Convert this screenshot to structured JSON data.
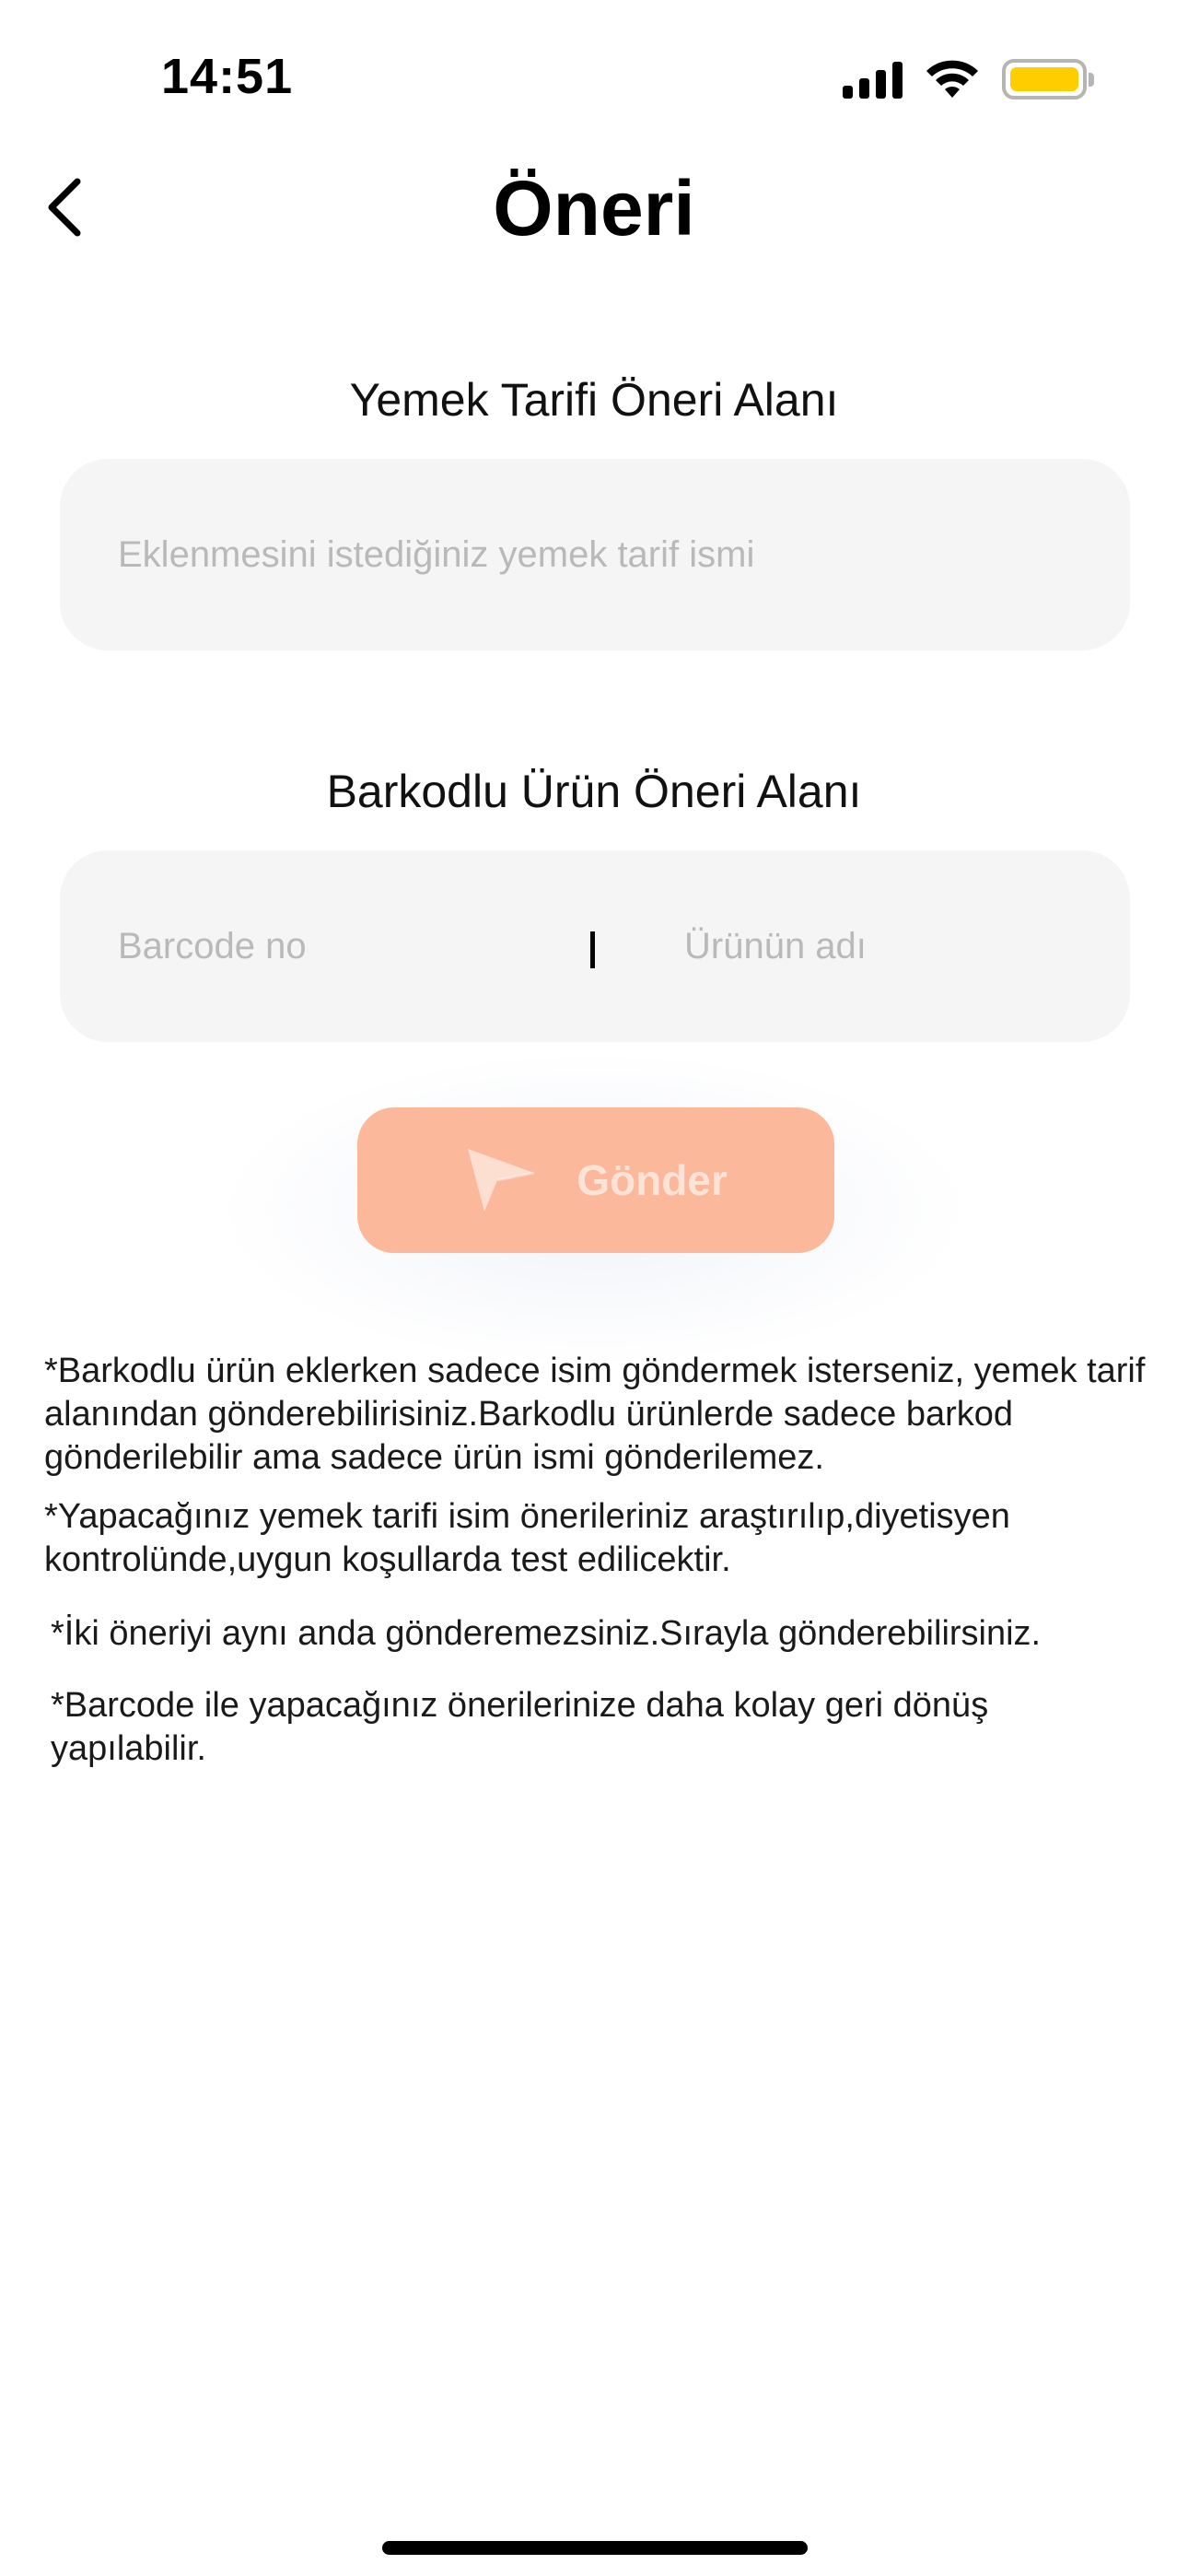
{
  "status_bar": {
    "time": "14:51"
  },
  "header": {
    "title": "Öneri"
  },
  "recipe_section": {
    "label": "Yemek Tarifi Öneri Alanı",
    "placeholder": "Eklenmesini istediğiniz yemek tarif ismi"
  },
  "barcode_section": {
    "label": "Barkodlu Ürün Öneri Alanı",
    "barcode_placeholder": "Barcode no",
    "product_placeholder": "Ürünün adı"
  },
  "send_button": {
    "label": "Gönder",
    "color": "#fbb89b"
  },
  "notes": [
    "*Barkodlu ürün eklerken sadece isim göndermek isterseniz, yemek tarif alanından gönderebilirisiniz.Barkodlu ürünlerde sadece barkod gönderilebilir ama sadece ürün ismi gönderilemez.",
    "*Yapacağınız yemek tarifi isim önerileriniz araştırılıp,diyetisyen kontrolünde,uygun koşullarda test edilicektir.",
    "*İki öneriyi aynı anda gönderemezsiniz.Sırayla gönderebilirsiniz.",
    "*Barcode ile yapacağınız önerilerinize daha kolay geri dönüş yapılabilir."
  ],
  "icons": {
    "back": "chevron-left-icon",
    "send": "paper-plane-icon",
    "signal": "cellular-signal-icon",
    "wifi": "wifi-icon",
    "battery": "battery-icon"
  },
  "colors": {
    "battery_fill": "#ffcd00",
    "field_bg": "#f5f5f5"
  }
}
